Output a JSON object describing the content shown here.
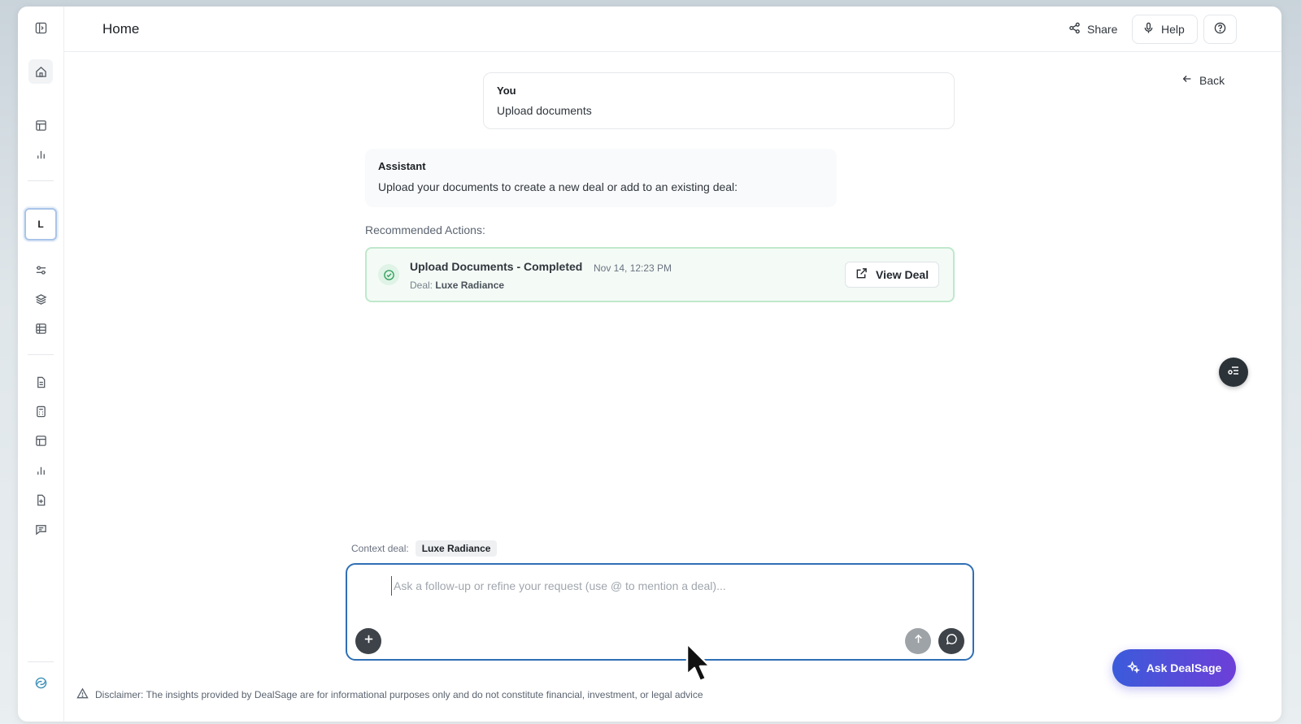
{
  "header": {
    "title": "Home",
    "share_label": "Share",
    "help_label": "Help"
  },
  "sidebar": {
    "workspace_initial": "L",
    "items": [
      {
        "icon": "panel-toggle-icon"
      },
      {
        "icon": "home-icon"
      },
      {
        "icon": "table-icon"
      },
      {
        "icon": "bar-chart-icon"
      },
      {
        "icon": "sliders-icon"
      },
      {
        "icon": "layers-icon"
      },
      {
        "icon": "grid-icon"
      },
      {
        "icon": "document-icon"
      },
      {
        "icon": "calculator-icon"
      },
      {
        "icon": "table-icon"
      },
      {
        "icon": "bar-chart-icon"
      },
      {
        "icon": "file-plus-icon"
      },
      {
        "icon": "message-icon"
      },
      {
        "icon": "logo-icon"
      }
    ]
  },
  "conversation": {
    "back_label": "Back",
    "user": {
      "role": "You",
      "text": "Upload documents"
    },
    "assistant": {
      "role": "Assistant",
      "text": "Upload your documents to create a new deal or add to an existing deal:"
    },
    "recommended_label": "Recommended Actions:",
    "action": {
      "title": "Upload Documents - Completed",
      "timestamp": "Nov 14, 12:23 PM",
      "deal_prefix": "Deal:",
      "deal_name": "Luxe Radiance",
      "button_label": "View Deal"
    }
  },
  "composer": {
    "context_label": "Context deal:",
    "context_deal": "Luxe Radiance",
    "placeholder": "Ask a follow-up or refine your request (use @ to mention a deal)...",
    "value": ""
  },
  "ask_button_label": "Ask DealSage",
  "disclaimer": "Disclaimer: The insights provided by DealSage are for informational purposes only and do not constitute financial, investment, or legal advice",
  "colors": {
    "accent": "#2f6fb5",
    "success_border": "#bfe8cc",
    "ask_gradient_start": "#3b5bdb",
    "ask_gradient_end": "#6d3fd8"
  }
}
